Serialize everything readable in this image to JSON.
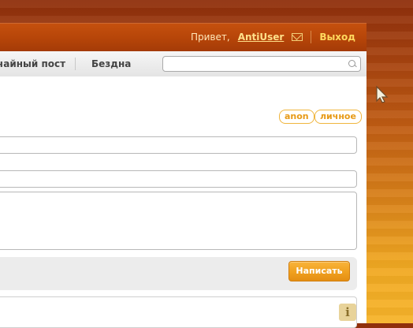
{
  "header": {
    "greeting": "Привет,",
    "username": "AntiUser",
    "mail_icon": "mail-icon",
    "logout_label": "Выход"
  },
  "nav": {
    "items": [
      {
        "label": "чайный пост"
      },
      {
        "label": "Бездна"
      }
    ],
    "search": {
      "placeholder": "",
      "icon": "search-icon"
    }
  },
  "form": {
    "tags": [
      {
        "label": "anon"
      },
      {
        "label": "личное"
      }
    ],
    "title_value": "",
    "link_value": "",
    "body_value": "",
    "submit_label": "Написать",
    "info_icon": "info-icon",
    "info_glyph": "i"
  },
  "colors": {
    "accent": "#f0a01f",
    "header_dark": "#b64509",
    "link": "#ffe08a"
  }
}
